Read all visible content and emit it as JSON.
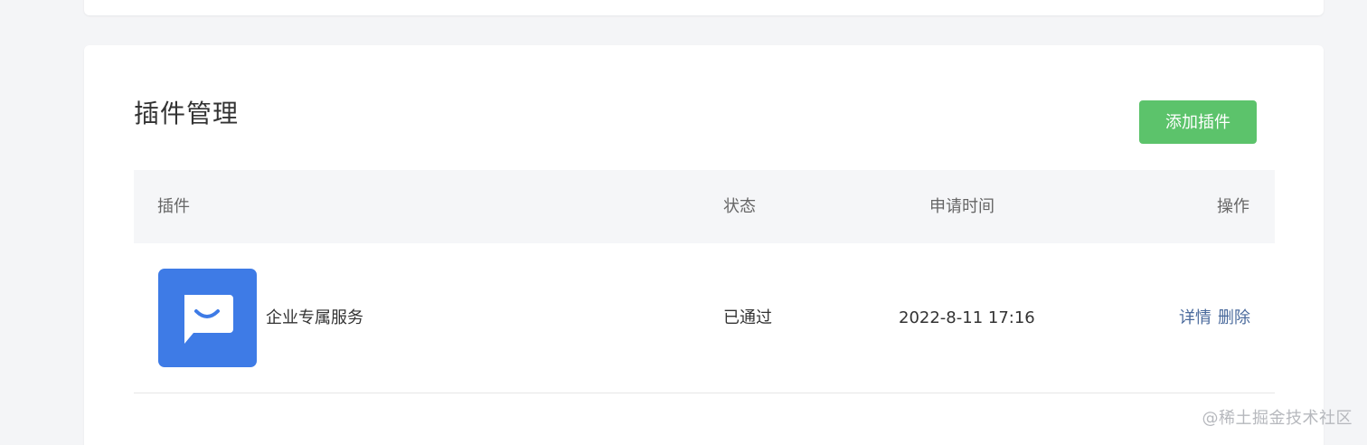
{
  "plugin_management": {
    "title": "插件管理",
    "add_button_label": "添加插件"
  },
  "table": {
    "headers": {
      "plugin": "插件",
      "status": "状态",
      "apply_time": "申请时间",
      "actions": "操作"
    },
    "rows": [
      {
        "icon": "chat-bubble-smile-icon",
        "name": "企业专属服务",
        "status": "已通过",
        "apply_time": "2022-8-11 17:16",
        "detail_label": "详情",
        "delete_label": "删除"
      }
    ]
  },
  "watermark": "@稀土掘金技术社区",
  "colors": {
    "primary_button": "#5cc36b",
    "plugin_icon_bg": "#3e7be6",
    "link": "#4a6a9c",
    "table_header_bg": "#f5f6f8",
    "page_bg": "#f4f5f7"
  }
}
